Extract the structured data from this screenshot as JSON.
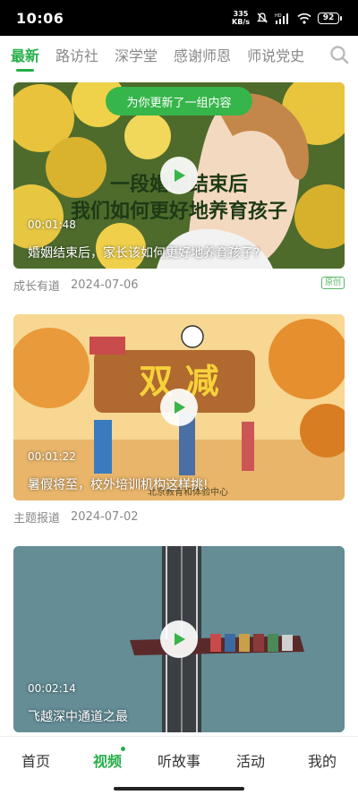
{
  "status_bar": {
    "time": "10:06",
    "net_speed_value": "335",
    "net_speed_unit": "KB/s",
    "battery": "92",
    "icons": [
      "mute-icon",
      "hd-icon",
      "signal-icon",
      "wifi-icon",
      "battery-icon"
    ]
  },
  "tabs": [
    {
      "label": "最新",
      "active": true
    },
    {
      "label": "路访社",
      "active": false
    },
    {
      "label": "深学堂",
      "active": false
    },
    {
      "label": "感谢师恩",
      "active": false
    },
    {
      "label": "师说党史",
      "active": false
    }
  ],
  "toast": "为你更新了一组内容",
  "videos": [
    {
      "overlay_line1": "一段婚姻结束后",
      "overlay_line2": "我们如何更好地养育孩子",
      "duration": "00:01:48",
      "title": "婚姻结束后，家长该如何更好地养育孩子?",
      "source": "成长有道",
      "date": "2024-07-06",
      "badge": "原创"
    },
    {
      "overlay_line1": "双  减",
      "overlay_line2": "北京教育和体验中心",
      "duration": "00:01:22",
      "title": "暑假将至，校外培训机构这样挑!",
      "source": "主题报道",
      "date": "2024-07-02",
      "badge": ""
    },
    {
      "duration": "00:02:14",
      "title": "飞越深中通道之最"
    }
  ],
  "bottom_nav": [
    {
      "label": "首页",
      "active": false
    },
    {
      "label": "视频",
      "active": true
    },
    {
      "label": "听故事",
      "active": false
    },
    {
      "label": "活动",
      "active": false
    },
    {
      "label": "我的",
      "active": false
    }
  ],
  "colors": {
    "accent": "#27ae4a",
    "toast": "#36b54a",
    "muted": "#888888"
  }
}
